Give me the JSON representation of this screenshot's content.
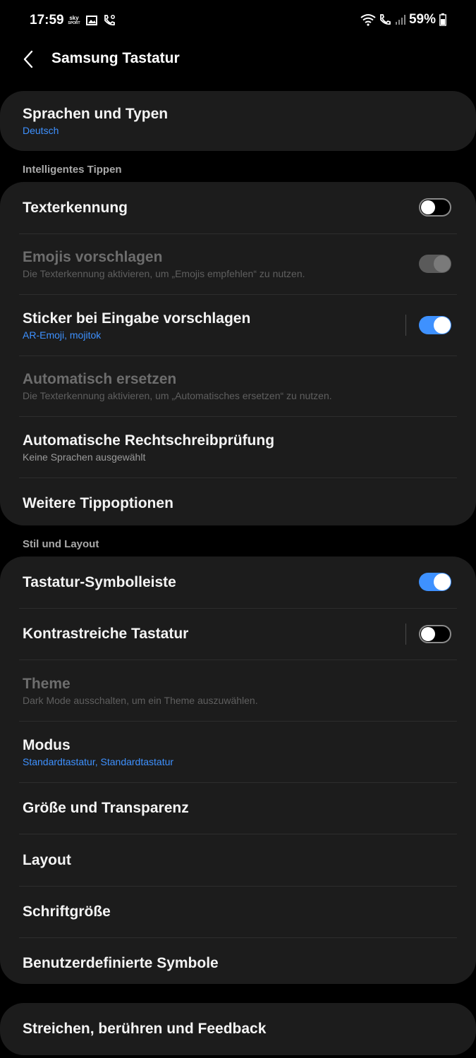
{
  "status_bar": {
    "time": "17:59",
    "sky_line1": "sky",
    "sky_line2": "SPORT",
    "battery": "59%"
  },
  "app_bar": {
    "title": "Samsung Tastatur"
  },
  "languages": {
    "title": "Sprachen und Typen",
    "subtitle": "Deutsch"
  },
  "smart_typing": {
    "header": "Intelligentes Tippen",
    "items": [
      {
        "title": "Texterkennung",
        "toggle": "off"
      },
      {
        "title": "Emojis vorschlagen",
        "subtitle": "Die Texterkennung aktivieren, um „Emojis empfehlen“ zu nutzen.",
        "toggle": "on-disabled"
      },
      {
        "title": "Sticker bei Eingabe vorschlagen",
        "subtitle": "AR-Emoji, mojitok",
        "toggle": "on"
      },
      {
        "title": "Automatisch ersetzen",
        "subtitle": "Die Texterkennung aktivieren, um „Automatisches ersetzen“ zu nutzen."
      },
      {
        "title": "Automatische Rechtschreibprüfung",
        "subtitle": "Keine Sprachen ausgewählt"
      },
      {
        "title": "Weitere Tippoptionen"
      }
    ]
  },
  "style_layout": {
    "header": "Stil und Layout",
    "items": [
      {
        "title": "Tastatur-Symbolleiste",
        "toggle": "on"
      },
      {
        "title": "Kontrastreiche Tastatur",
        "toggle": "off"
      },
      {
        "title": "Theme",
        "subtitle": "Dark Mode ausschalten, um ein Theme auszuwählen."
      },
      {
        "title": "Modus",
        "subtitle": "Standardtastatur, Standardtastatur"
      },
      {
        "title": "Größe und Transparenz"
      },
      {
        "title": "Layout"
      },
      {
        "title": "Schriftgröße"
      },
      {
        "title": "Benutzerdefinierte Symbole"
      }
    ]
  },
  "feedback": {
    "title": "Streichen, berühren und Feedback"
  },
  "colors": {
    "accent": "#3e91ff",
    "card": "#1c1c1c",
    "background": "#000000"
  }
}
